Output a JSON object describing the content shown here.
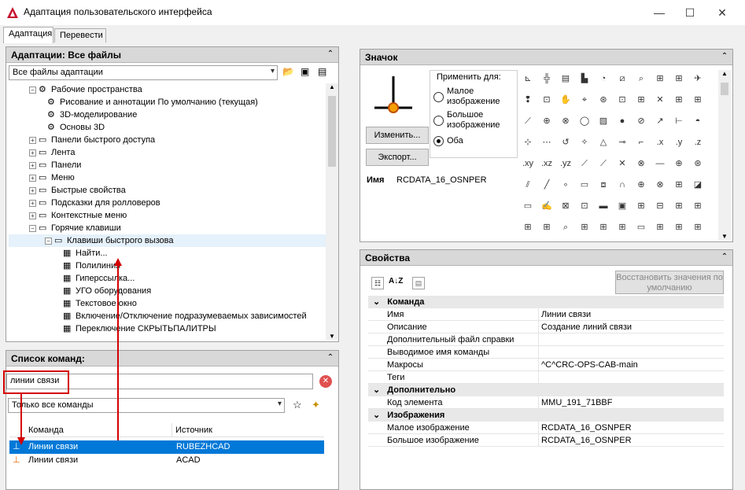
{
  "window": {
    "title": "Адаптация пользовательского интерфейса"
  },
  "tabs": [
    "Адаптация",
    "Перевести"
  ],
  "left_top": {
    "header": "Адаптации: Все файлы",
    "file_combo": "Все файлы адаптации",
    "tree": [
      {
        "label": "Рабочие пространства",
        "indent": 1
      },
      {
        "label": "Рисование и аннотации По умолчанию (текущая)",
        "indent": 2
      },
      {
        "label": "3D-моделирование",
        "indent": 2
      },
      {
        "label": "Основы 3D",
        "indent": 2
      },
      {
        "label": "Панели быстрого доступа",
        "indent": 1
      },
      {
        "label": "Лента",
        "indent": 1
      },
      {
        "label": "Панели",
        "indent": 1
      },
      {
        "label": "Меню",
        "indent": 1
      },
      {
        "label": "Быстрые свойства",
        "indent": 1
      },
      {
        "label": "Подсказки для ролловеров",
        "indent": 1
      },
      {
        "label": "Контекстные меню",
        "indent": 1
      },
      {
        "label": "Горячие клавиши",
        "indent": 1
      },
      {
        "label": "Клавиши быстрого вызова",
        "indent": 2
      },
      {
        "label": "Найти...",
        "indent": 3
      },
      {
        "label": "Полилиния",
        "indent": 3
      },
      {
        "label": "Гиперссылка...",
        "indent": 3
      },
      {
        "label": "УГО оборудования",
        "indent": 3
      },
      {
        "label": "Текстовое окно",
        "indent": 3
      },
      {
        "label": "Включение/Отключение подразумеваемых зависимостей",
        "indent": 3
      },
      {
        "label": "Переключение СКРЫТЬПАЛИТРЫ",
        "indent": 3
      }
    ]
  },
  "commands": {
    "header": "Список команд:",
    "search_value": "линии связи",
    "filter": "Только все команды",
    "col_command": "Команда",
    "col_source": "Источник",
    "rows": [
      {
        "command": "Линии связи",
        "source": "RUBEZHCAD"
      },
      {
        "command": "Линии связи",
        "source": "ACAD"
      }
    ]
  },
  "icon_panel": {
    "header": "Значок",
    "apply_label": "Применить для:",
    "options": [
      "Малое изображение",
      "Большое изображение",
      "Оба"
    ],
    "selected_option": "Оба",
    "edit_button": "Изменить...",
    "export_button": "Экспорт...",
    "name_label": "Имя",
    "name_value": "RCDATA_16_OSNPER",
    "grid_glyphs": [
      "⊾",
      "╬",
      "▤",
      "▙",
      "◔",
      "⧄",
      "⌕",
      "⊞",
      "⊞",
      "✈",
      "❢",
      "⊡",
      "✋",
      "⌖",
      "⊛",
      "⊡",
      "⊞",
      "✕",
      "⊞",
      "⊞",
      "⟋",
      "⊕",
      "⊗",
      "◯",
      "▨",
      "●",
      "⊘",
      "↗",
      "⊢",
      "◓",
      "⊹",
      "⋯",
      "↺",
      "✧",
      "△",
      "⊸",
      "⌐",
      ".x",
      ".y",
      ".z",
      ".xy",
      ".xz",
      ".yz",
      "⟋",
      "⟋",
      "✕",
      "⊗",
      "—",
      "⊕",
      "⊛",
      "⫽",
      "╱",
      "∘",
      "▭",
      "⧈",
      "∩",
      "⊕",
      "⊗",
      "⊞",
      "◪",
      "▭",
      "✍",
      "⊠",
      "⊡",
      "▬",
      "▣",
      "⊞",
      "⊟",
      "⊞",
      "⊞",
      "⊞",
      "⊞",
      "⌕",
      "⊞",
      "⊞",
      "⊞",
      "▭",
      "⊞",
      "⊞",
      "⊞"
    ]
  },
  "props": {
    "header": "Свойства",
    "restore_button": "Восстановить значения по умолчанию",
    "categories": [
      {
        "name": "Команда",
        "rows": [
          {
            "k": "Имя",
            "v": "Линии связи"
          },
          {
            "k": "Описание",
            "v": "Создание линий связи"
          },
          {
            "k": "Дополнительный файл справки",
            "v": ""
          },
          {
            "k": "Выводимое имя команды",
            "v": ""
          },
          {
            "k": "Макросы",
            "v": "^C^CRC-OPS-CAB-main"
          },
          {
            "k": "Теги",
            "v": ""
          }
        ]
      },
      {
        "name": "Дополнительно",
        "rows": [
          {
            "k": "Код элемента",
            "v": "MMU_191_71BBF"
          }
        ]
      },
      {
        "name": "Изображения",
        "rows": [
          {
            "k": "Малое изображение",
            "v": "RCDATA_16_OSNPER"
          },
          {
            "k": "Большое изображение",
            "v": "RCDATA_16_OSNPER"
          }
        ]
      }
    ]
  },
  "colors": {
    "selection": "#0078d7",
    "annotation": "#d40000"
  }
}
